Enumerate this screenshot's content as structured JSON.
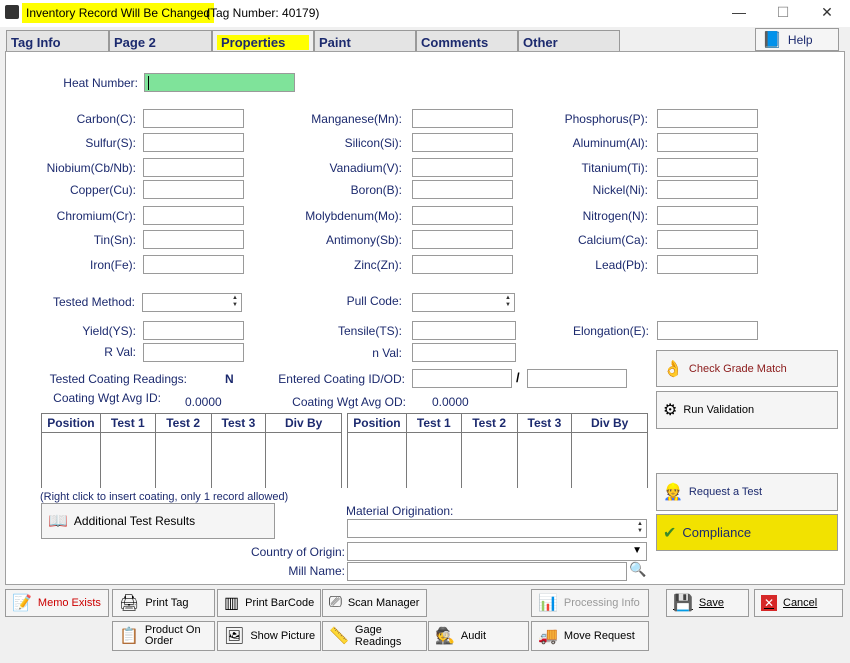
{
  "window": {
    "title_highlight": "Inventory Record Will Be Changed",
    "title_tag": "(Tag Number: 40179)",
    "minimize_glyph": "—",
    "maximize_glyph": "☐",
    "close_glyph": "✕"
  },
  "tabs": [
    {
      "label": "Tag Info"
    },
    {
      "label": "Page 2"
    },
    {
      "label": "Properties"
    },
    {
      "label": "Paint"
    },
    {
      "label": "Comments"
    },
    {
      "label": "Other"
    }
  ],
  "help_label": "Help",
  "heat_number": {
    "label": "Heat Number:",
    "value": ""
  },
  "elements": {
    "col1": [
      "Carbon(C):",
      "Sulfur(S):",
      "Niobium(Cb/Nb):",
      "Copper(Cu):",
      "Chromium(Cr):",
      "Tin(Sn):",
      "Iron(Fe):"
    ],
    "col2": [
      "Manganese(Mn):",
      "Silicon(Si):",
      "Vanadium(V):",
      "Boron(B):",
      "Molybdenum(Mo):",
      "Antimony(Sb):",
      "Zinc(Zn):"
    ],
    "col3": [
      "Phosphorus(P):",
      "Aluminum(Al):",
      "Titanium(Ti):",
      "Nickel(Ni):",
      "Nitrogen(N):",
      "Calcium(Ca):",
      "Lead(Pb):"
    ]
  },
  "tested_method_label": "Tested Method:",
  "pull_code_label": "Pull Code:",
  "yield_label": "Yield(YS):",
  "tensile_label": "Tensile(TS):",
  "elongation_label": "Elongation(E):",
  "r_val_label": "R Val:",
  "n_val_label": "n Val:",
  "tested_coating_label": "Tested Coating Readings:",
  "tested_coating_value": "N",
  "entered_coating_label": "Entered Coating ID/OD:",
  "coating_separator": "/",
  "coating_avg_id_label": "Coating Wgt Avg ID:",
  "coating_avg_id_value": "0.0000",
  "coating_avg_od_label": "Coating Wgt Avg OD:",
  "coating_avg_od_value": "0.0000",
  "grid_columns": [
    "Position",
    "Test 1",
    "Test 2",
    "Test 3",
    "Div By"
  ],
  "grid_note": "(Right click to insert coating, only 1 record allowed)",
  "additional_tests_label": "Additional Test Results",
  "material_origination_label": "Material Origination:",
  "country_label": "Country of Origin:",
  "mill_name_label": "Mill Name:",
  "side_buttons": {
    "check_grade": "Check Grade Match",
    "run_validation": "Run Validation",
    "request_test": "Request a Test",
    "compliance": "Compliance"
  },
  "bottom_buttons": {
    "memo": "Memo Exists",
    "print_tag": "Print Tag",
    "print_barcode": "Print BarCode",
    "scan_manager": "Scan Manager",
    "processing_info": "Processing Info",
    "save": "Save",
    "cancel": "Cancel",
    "product_on_order": "Product On Order",
    "show_picture": "Show Picture",
    "gage_readings": "Gage Readings",
    "audit": "Audit",
    "move_request": "Move Request"
  },
  "colors": {
    "heat_field": "#7fe39a",
    "compliance_bg": "#f2e200",
    "title_highlight": "#ffff00",
    "label_text": "#1c2a6e",
    "memo_text": "#cc0000"
  }
}
